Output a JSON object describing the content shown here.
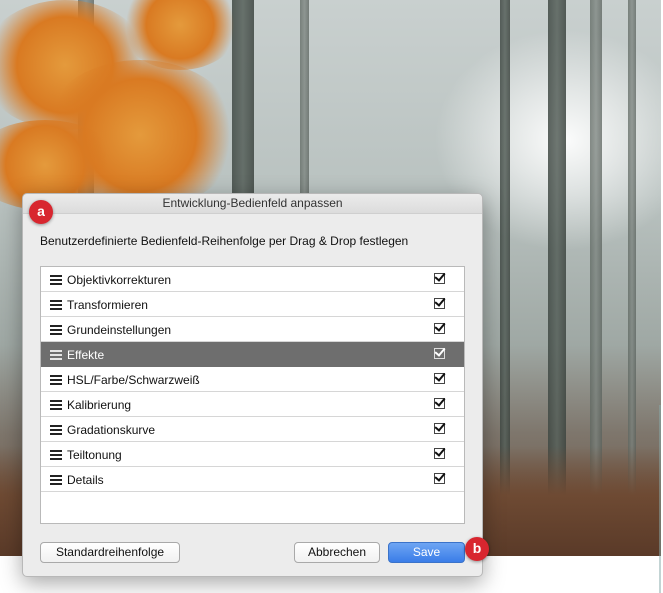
{
  "dialog": {
    "title": "Entwicklung-Bedienfeld anpassen",
    "instruction": "Benutzerdefinierte Bedienfeld-Reihenfolge per Drag & Drop festlegen",
    "panels": [
      {
        "label": "Objektivkorrekturen",
        "checked": true,
        "selected": false
      },
      {
        "label": "Transformieren",
        "checked": true,
        "selected": false
      },
      {
        "label": "Grundeinstellungen",
        "checked": true,
        "selected": false
      },
      {
        "label": "Effekte",
        "checked": true,
        "selected": true
      },
      {
        "label": "HSL/Farbe/Schwarzweiß",
        "checked": true,
        "selected": false
      },
      {
        "label": "Kalibrierung",
        "checked": true,
        "selected": false
      },
      {
        "label": "Gradationskurve",
        "checked": true,
        "selected": false
      },
      {
        "label": "Teiltonung",
        "checked": true,
        "selected": false
      },
      {
        "label": "Details",
        "checked": true,
        "selected": false
      }
    ],
    "buttons": {
      "default_order": "Standardreihenfolge",
      "cancel": "Abbrechen",
      "save": "Save"
    }
  },
  "annotations": {
    "a": "a",
    "b": "b"
  },
  "colors": {
    "badge": "#d8262f",
    "selected_row": "#6e6e6e",
    "save_button": "#3a7de8",
    "foliage": "#d97a22"
  },
  "icons": {
    "row_grip": "drag-handle-icon",
    "row_check": "checkbox-checked-icon"
  }
}
